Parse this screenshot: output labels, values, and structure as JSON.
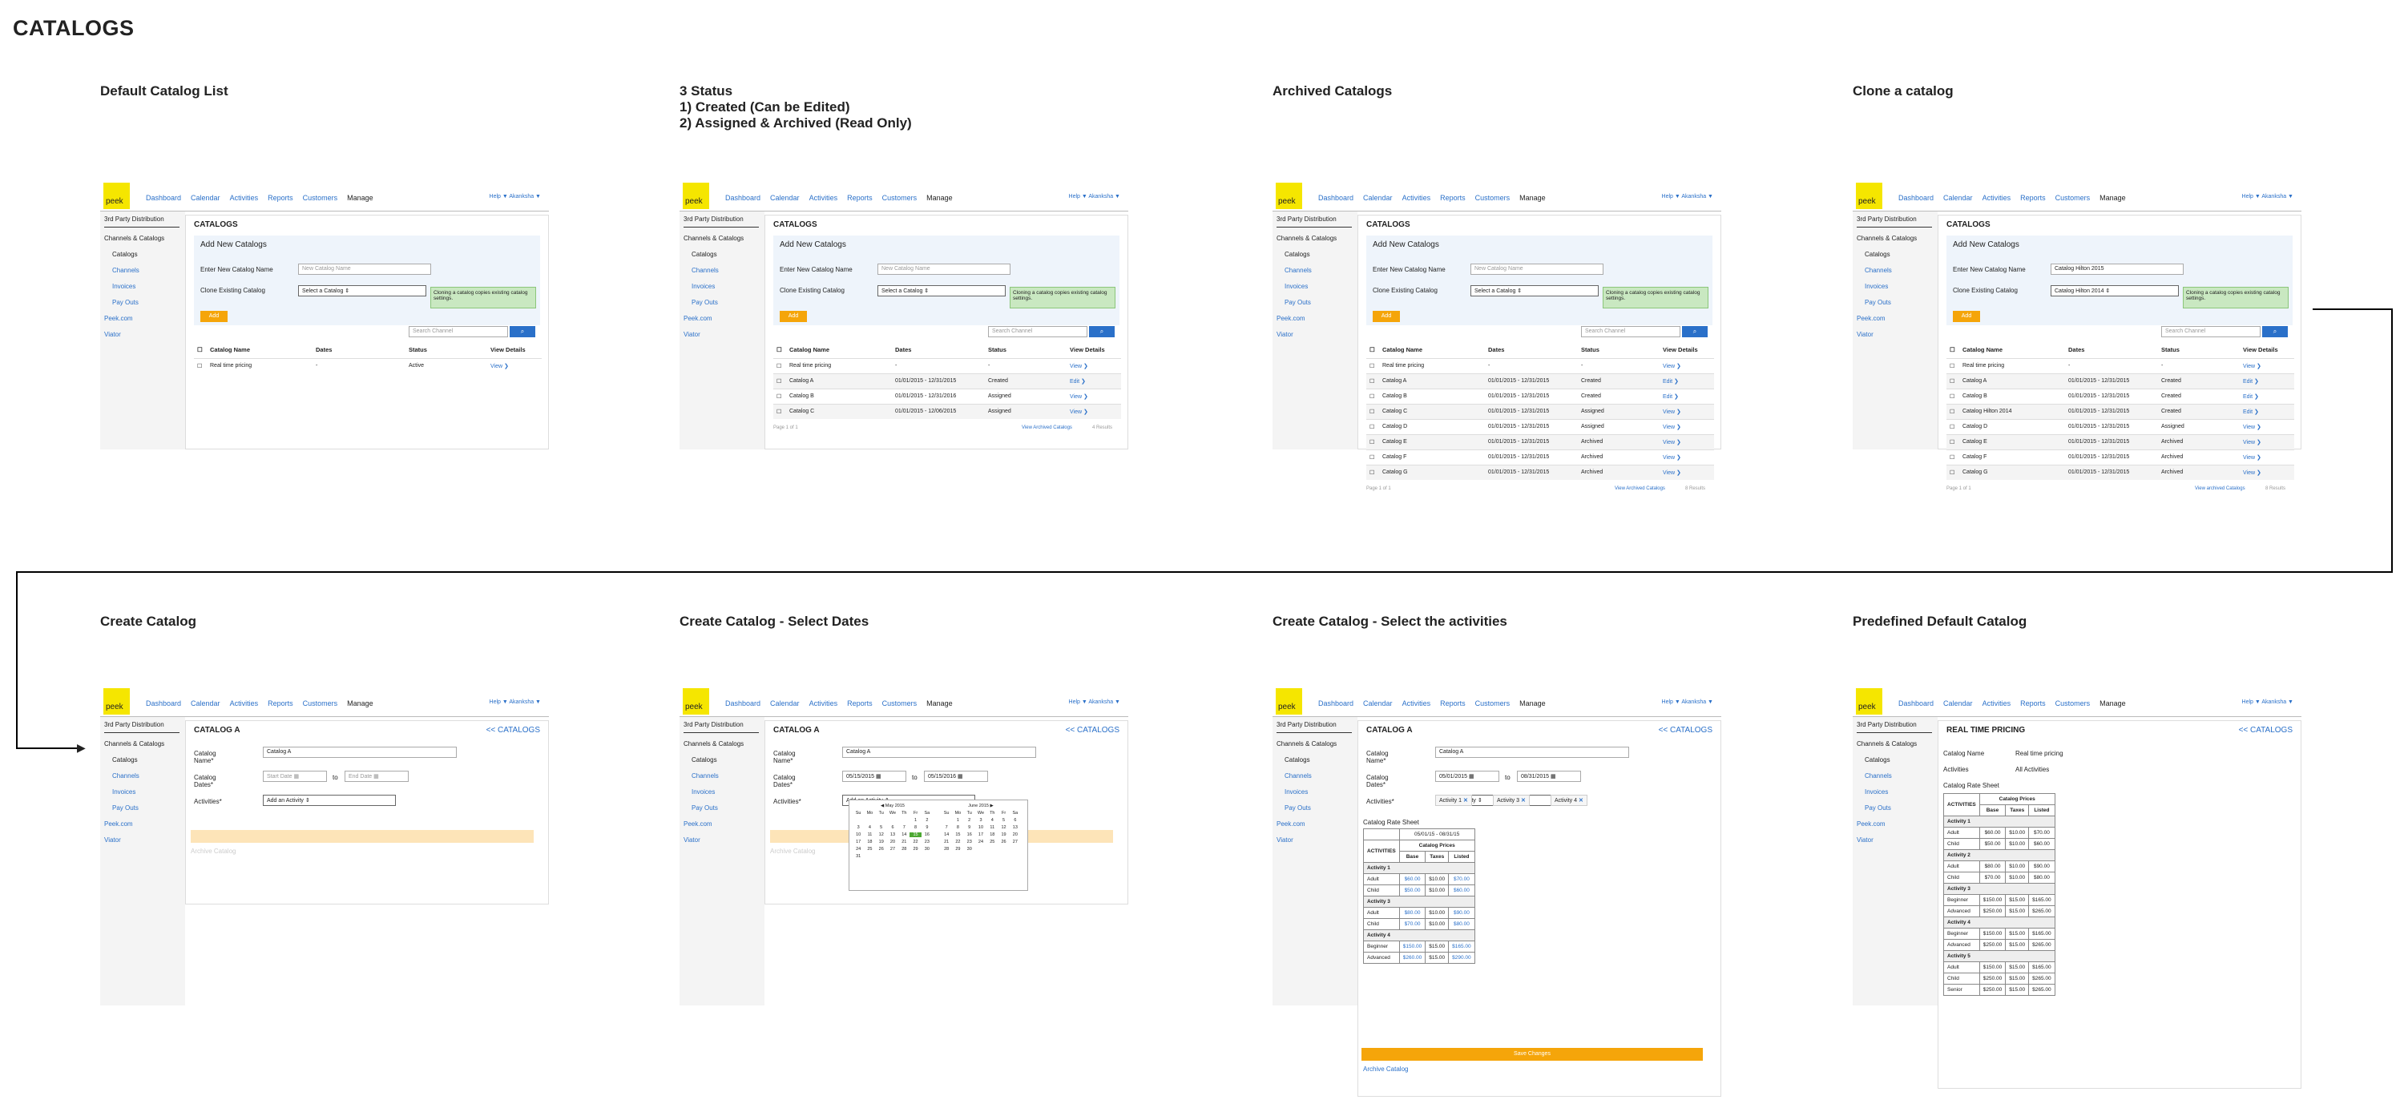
{
  "page_title": "CATALOGS",
  "captions": [
    "Default Catalog List",
    "3 Status\n1) Created (Can be Edited)\n2) Assigned & Archived (Read Only)",
    "Archived Catalogs",
    "Clone a catalog",
    "Create Catalog",
    "Create Catalog - Select Dates",
    "Create Catalog - Select the activities",
    "Predefined Default Catalog"
  ],
  "app": {
    "logo": "peek",
    "nav": [
      "Dashboard",
      "Calendar",
      "Activities",
      "Reports",
      "Customers",
      "Manage"
    ],
    "help": "Help ▼   Akanksha ▼",
    "sidebar": [
      "3rd Party Distribution",
      "Channels & Catalogs",
      "Catalogs",
      "Channels",
      "Invoices",
      "Pay Outs",
      "Peek.com",
      "Viator"
    ]
  },
  "list": {
    "title": "CATALOGS",
    "add_title": "Add New Catalogs",
    "name_label": "Enter New Catalog Name",
    "name_placeholder": "New Catalog Name",
    "clone_label": "Clone Existing Catalog",
    "select_placeholder": "Select a Catalog",
    "clone_note": "Cloning a catalog copies existing catalog settings.",
    "add_btn": "Add",
    "search_placeholder": "Search Channel",
    "headers": [
      "Catalog Name",
      "Dates",
      "Status",
      "View Details"
    ],
    "page": "Page 1 of 1",
    "view_archived": "View Archived Catalogs",
    "view_archived_lower": "View archived Catalogs",
    "results": "4 Results",
    "results7": "8 Results",
    "rows1": [
      [
        "Real time pricing",
        "-",
        "Active",
        "View"
      ]
    ],
    "rows2": [
      [
        "Real time pricing",
        "-",
        "-",
        "View"
      ],
      [
        "Catalog A",
        "01/01/2015 - 12/31/2015",
        "Created",
        "Edit"
      ],
      [
        "Catalog B",
        "01/01/2015 - 12/31/2016",
        "Assigned",
        "View"
      ],
      [
        "Catalog C",
        "01/01/2015 - 12/06/2015",
        "Assigned",
        "View"
      ]
    ],
    "rows3": [
      [
        "Real time pricing",
        "-",
        "-",
        "View"
      ],
      [
        "Catalog A",
        "01/01/2015 - 12/31/2015",
        "Created",
        "Edit"
      ],
      [
        "Catalog B",
        "01/01/2015 - 12/31/2015",
        "Created",
        "Edit"
      ],
      [
        "Catalog C",
        "01/01/2015 - 12/31/2015",
        "Assigned",
        "View"
      ],
      [
        "Catalog D",
        "01/01/2015 - 12/31/2015",
        "Assigned",
        "View"
      ],
      [
        "Catalog E",
        "01/01/2015 - 12/31/2015",
        "Archived",
        "View"
      ],
      [
        "Catalog F",
        "01/01/2015 - 12/31/2015",
        "Archived",
        "View"
      ],
      [
        "Catalog G",
        "01/01/2015 - 12/31/2015",
        "Archived",
        "View"
      ]
    ],
    "rows4": [
      [
        "Real time pricing",
        "-",
        "-",
        "View"
      ],
      [
        "Catalog A",
        "01/01/2015 - 12/31/2015",
        "Created",
        "Edit"
      ],
      [
        "Catalog B",
        "01/01/2015 - 12/31/2015",
        "Created",
        "Edit"
      ],
      [
        "Catalog Hilton 2014",
        "01/01/2015 - 12/31/2015",
        "Created",
        "Edit"
      ],
      [
        "Catalog D",
        "01/01/2015 - 12/31/2015",
        "Assigned",
        "View"
      ],
      [
        "Catalog E",
        "01/01/2015 - 12/31/2015",
        "Archived",
        "View"
      ],
      [
        "Catalog F",
        "01/01/2015 - 12/31/2015",
        "Archived",
        "View"
      ],
      [
        "Catalog G",
        "01/01/2015 - 12/31/2015",
        "Archived",
        "View"
      ]
    ],
    "clone_name": "Catalog Hilton 2015",
    "clone_select": "Catalog Hilton 2014"
  },
  "create": {
    "title": "CATALOG A",
    "back": "<< CATALOGS",
    "name_label": "Catalog Name*",
    "name_value": "Catalog A",
    "dates_label": "Catalog Dates*",
    "start_placeholder": "Start Date",
    "end_placeholder": "End Date",
    "to": "to",
    "activities_label": "Activities*",
    "activity_select": "Add an Activity",
    "archive_faded": "Archive Catalog",
    "start_date": "05/15/2015",
    "end_date": "05/15/2016",
    "start_date3": "05/01/2015",
    "end_date3": "08/31/2015",
    "cal_months": [
      "May 2015",
      "June 2015"
    ],
    "cal_days": [
      "Su",
      "Mo",
      "Tu",
      "We",
      "Th",
      "Fr",
      "Sa"
    ],
    "tags": [
      "Activity 1",
      "Activity 3",
      "Activity 4"
    ],
    "rate_sheet": "Catalog Rate Sheet",
    "date_range": "05/01/15 - 08/31/15",
    "catalog_prices": "Catalog Prices",
    "activities": "ACTIVITIES",
    "cols": [
      "Base",
      "Taxes",
      "Listed"
    ],
    "rate_groups": [
      {
        "name": "Activity 1",
        "rows": [
          [
            "Adult",
            "$60.00",
            "$10.00",
            "$70.00"
          ],
          [
            "Child",
            "$50.00",
            "$10.00",
            "$60.00"
          ]
        ]
      },
      {
        "name": "Activity 3",
        "rows": [
          [
            "Adult",
            "$80.00",
            "$10.00",
            "$90.00"
          ],
          [
            "Child",
            "$70.00",
            "$10.00",
            "$80.00"
          ]
        ]
      },
      {
        "name": "Activity 4",
        "rows": [
          [
            "Beginner",
            "$150.00",
            "$15.00",
            "$165.00"
          ],
          [
            "Advanced",
            "$260.00",
            "$15.00",
            "$290.00"
          ]
        ]
      }
    ],
    "save": "Save Changes",
    "archive": "Archive Catalog"
  },
  "predefined": {
    "title": "REAL TIME PRICING",
    "name_label": "Catalog Name",
    "name_value": "Real time pricing",
    "act_label": "Activities",
    "act_value": "All Activities",
    "rate_label": "Catalog Rate Sheet",
    "groups": [
      {
        "name": "Activity 1",
        "rows": [
          [
            "Adult",
            "$60.00",
            "$10.00",
            "$70.00"
          ],
          [
            "Child",
            "$50.00",
            "$10.00",
            "$60.00"
          ]
        ]
      },
      {
        "name": "Activity 2",
        "rows": [
          [
            "Adult",
            "$80.00",
            "$10.00",
            "$90.00"
          ],
          [
            "Child",
            "$70.00",
            "$10.00",
            "$80.00"
          ]
        ]
      },
      {
        "name": "Activity 3",
        "rows": [
          [
            "Beginner",
            "$150.00",
            "$15.00",
            "$165.00"
          ],
          [
            "Advanced",
            "$250.00",
            "$15.00",
            "$265.00"
          ]
        ]
      },
      {
        "name": "Activity 4",
        "rows": [
          [
            "Beginner",
            "$150.00",
            "$15.00",
            "$165.00"
          ],
          [
            "Advanced",
            "$250.00",
            "$15.00",
            "$265.00"
          ]
        ]
      },
      {
        "name": "Activity 5",
        "rows": [
          [
            "Adult",
            "$150.00",
            "$15.00",
            "$165.00"
          ],
          [
            "Child",
            "$250.00",
            "$15.00",
            "$265.00"
          ],
          [
            "Senior",
            "$250.00",
            "$15.00",
            "$265.00"
          ]
        ]
      }
    ]
  }
}
